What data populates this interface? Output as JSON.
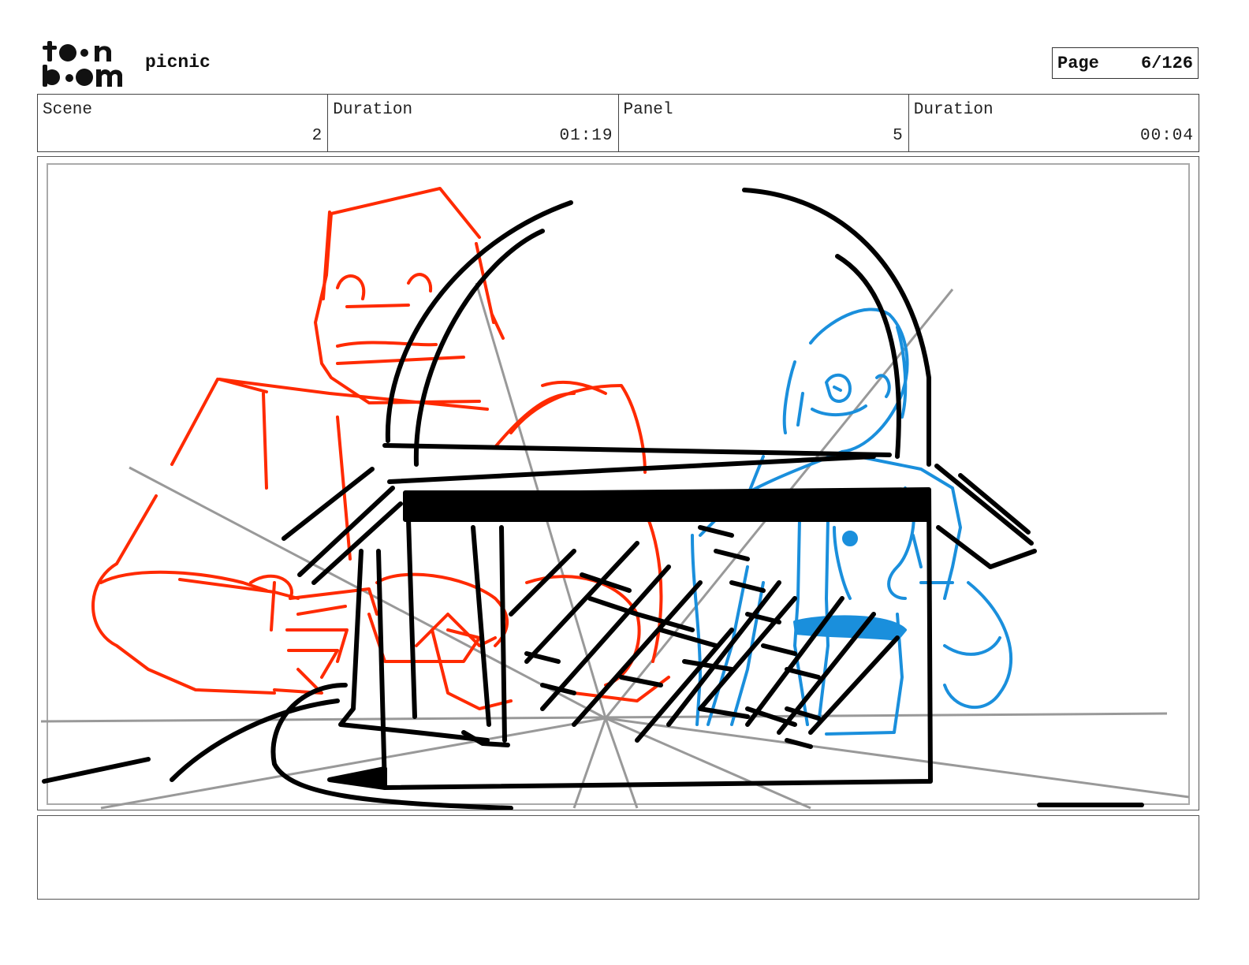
{
  "header": {
    "logo_text": "toon boom",
    "project_title": "picnic",
    "page_label": "Page",
    "page_value": "6/126"
  },
  "info": [
    {
      "label": "Scene",
      "value": "2"
    },
    {
      "label": "Duration",
      "value": "01:19"
    },
    {
      "label": "Panel",
      "value": "5"
    },
    {
      "label": "Duration",
      "value": "00:04"
    }
  ],
  "panel": {
    "sketch_colors": {
      "left_character": "#ff2a00",
      "right_character": "#1a8fdc",
      "basket": "#000000",
      "guides": "#999999"
    }
  },
  "notes": {
    "text": ""
  }
}
